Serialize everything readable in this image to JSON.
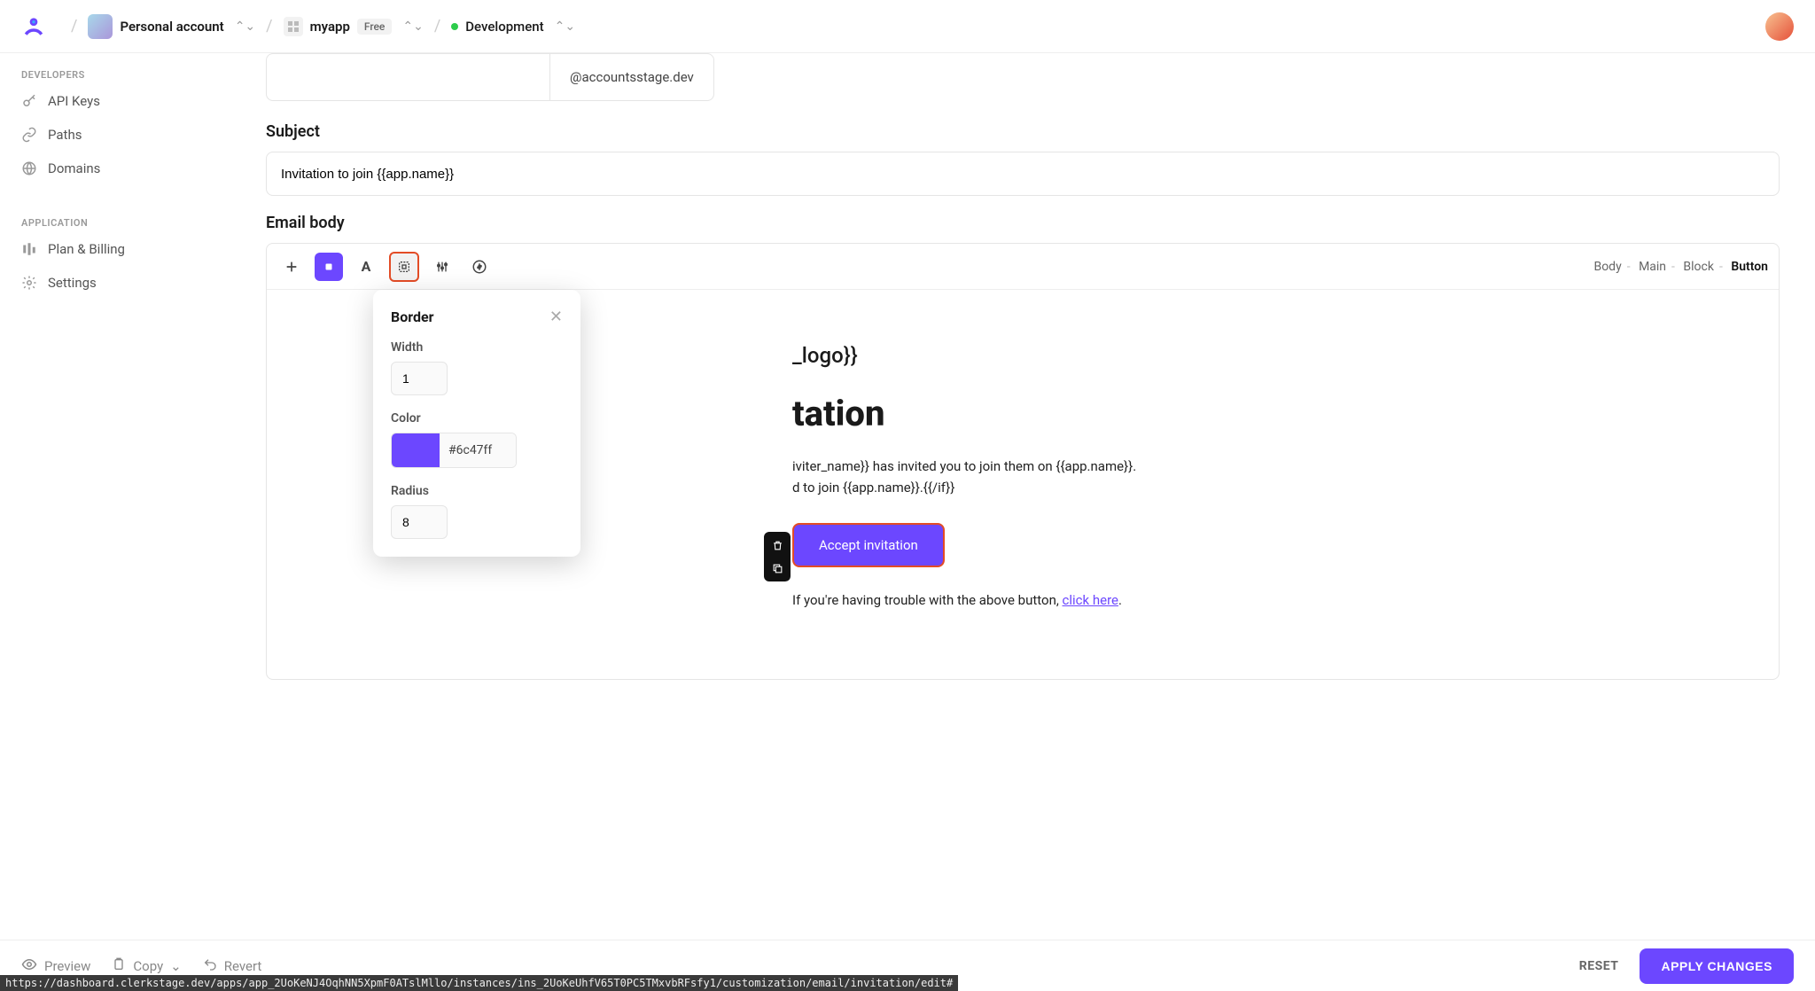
{
  "header": {
    "account_label": "Personal account",
    "app_label": "myapp",
    "app_badge": "Free",
    "env_label": "Development"
  },
  "sidebar": {
    "sections": [
      {
        "title": "DEVELOPERS",
        "items": [
          {
            "label": "API Keys",
            "icon": "key"
          },
          {
            "label": "Paths",
            "icon": "link"
          },
          {
            "label": "Domains",
            "icon": "globe"
          }
        ]
      },
      {
        "title": "APPLICATION",
        "items": [
          {
            "label": "Plan & Billing",
            "icon": "plan"
          },
          {
            "label": "Settings",
            "icon": "gear"
          }
        ]
      }
    ]
  },
  "form": {
    "domain_suffix": "@accountsstage.dev",
    "subject_label": "Subject",
    "subject_value": "Invitation to join {{app.name}}",
    "body_label": "Email body"
  },
  "editor": {
    "breadcrumb": [
      "Body",
      "Main",
      "Block",
      "Button"
    ]
  },
  "popover": {
    "title": "Border",
    "width_label": "Width",
    "width_value": "1",
    "color_label": "Color",
    "color_hex": "#6c47ff",
    "radius_label": "Radius",
    "radius_value": "8"
  },
  "email": {
    "logo_placeholder": "_logo}}",
    "title": "tation",
    "line1": "iviter_name}} has invited you to join them on {{app.name}}.",
    "line2": "d to join {{app.name}}.{{/if}}",
    "cta": "Accept invitation",
    "footer_text": "If you're having trouble with the above button, ",
    "footer_link": "click here",
    "footer_period": "."
  },
  "footer": {
    "preview": "Preview",
    "copy": "Copy",
    "revert": "Revert",
    "reset": "RESET",
    "apply": "APPLY CHANGES"
  },
  "status_url": "https://dashboard.clerkstage.dev/apps/app_2UoKeNJ4OqhNN5XpmF0ATslMllo/instances/ins_2UoKeUhfV65T0PC5TMxvbRFsfy1/customization/email/invitation/edit#"
}
